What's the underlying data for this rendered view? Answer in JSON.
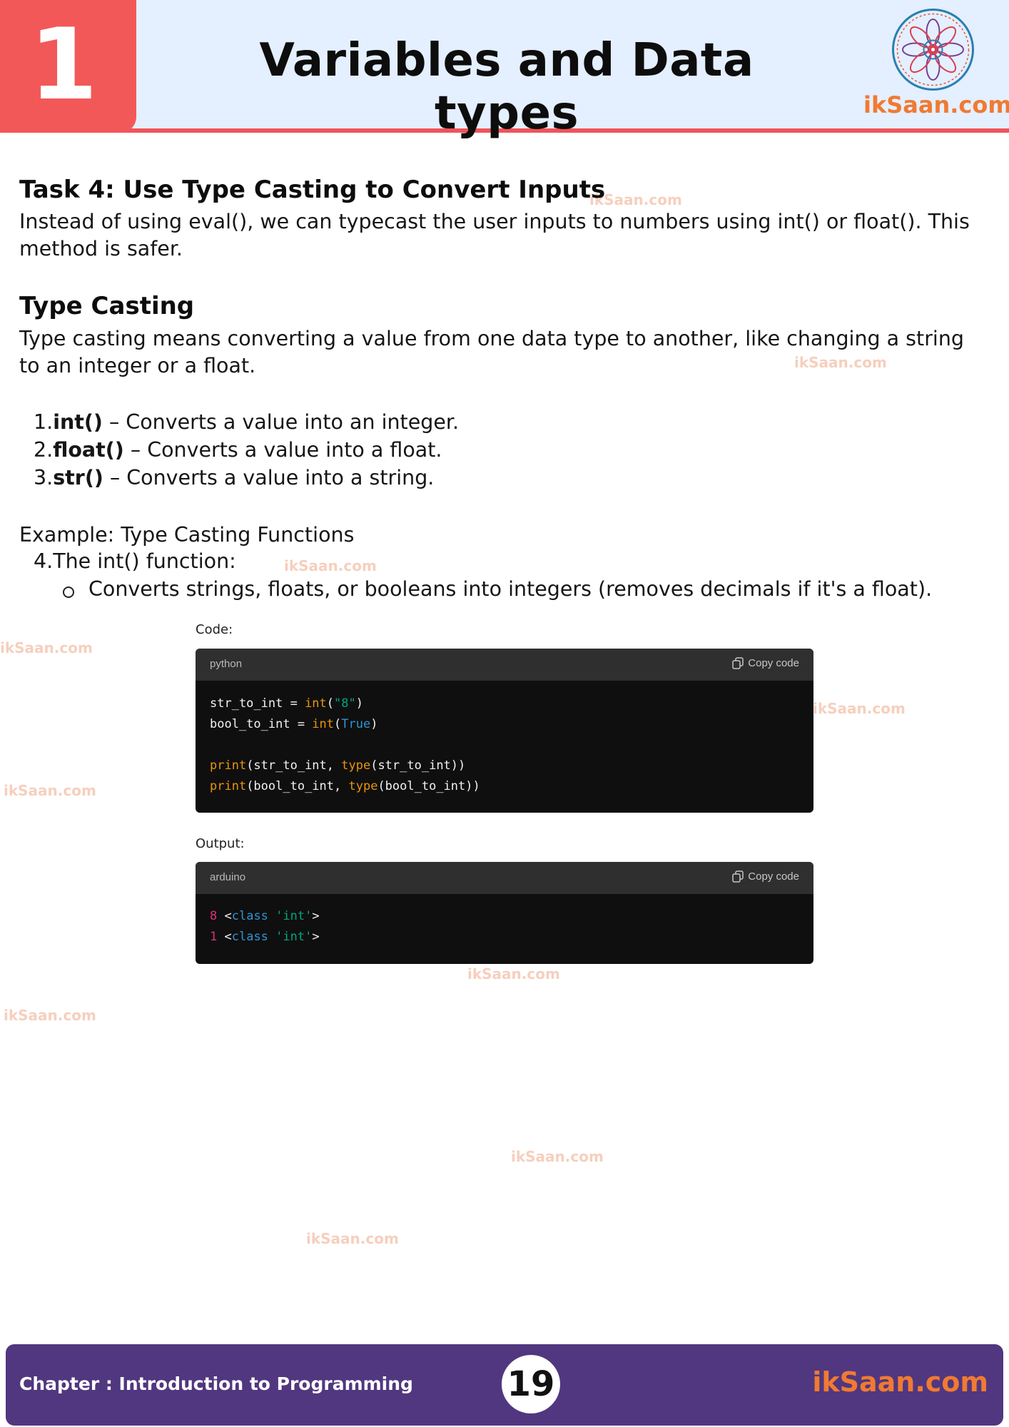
{
  "header": {
    "chapter_number": "1",
    "title": "Variables and Data types",
    "brand": "ikSaan.com",
    "logo_icon": "mandala-logo-icon"
  },
  "watermark_text": "ikSaan.com",
  "content": {
    "task_heading": "Task 4: Use Type Casting to Convert Inputs",
    "task_text": "Instead of using eval(), we can typecast the user inputs to numbers using int() or float(). This method is safer.",
    "type_casting_heading": "Type Casting",
    "type_casting_text": "Type casting means converting a value from one data type to another, like changing a string to an integer or a float.",
    "functions": [
      {
        "num": "1.",
        "name": "int()",
        "desc": " – Converts a value into an integer."
      },
      {
        "num": "2.",
        "name": "float()",
        "desc": " – Converts a value into a float."
      },
      {
        "num": "3.",
        "name": "str()",
        "desc": " – Converts a value into a string."
      }
    ],
    "example_heading": "Example: Type Casting Functions",
    "example_item_num": "4.",
    "example_item": "The int() function:",
    "example_bullet": "Converts strings, floats, or booleans into integers (removes decimals if it's a float)."
  },
  "code_section": {
    "label": "Code:",
    "language": "python",
    "copy_label": "Copy code",
    "lines": [
      "str_to_int = int(\"8\")",
      "bool_to_int = int(True)",
      "",
      "print(str_to_int, type(str_to_int))",
      "print(bool_to_int, type(bool_to_int))"
    ]
  },
  "output_section": {
    "label": "Output:",
    "language": "arduino",
    "copy_label": "Copy code",
    "lines": [
      "8 <class 'int'>",
      "1 <class 'int'>"
    ]
  },
  "footer": {
    "chapter_label": "Chapter : Introduction to Programming",
    "page_number": "19",
    "brand": "ikSaan.com"
  },
  "colors": {
    "header_bg": "#e4efff",
    "chapter_box": "#f35858",
    "brand_orange": "#f07a32",
    "footer_bg": "#51377f",
    "code_bg": "#0f0f0f"
  }
}
